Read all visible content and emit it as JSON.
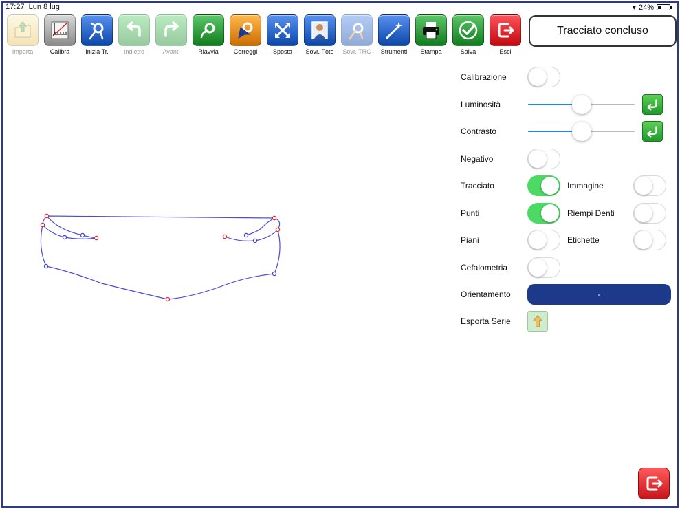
{
  "status_bar": {
    "time": "17:27",
    "date": "Lun 8 lug",
    "battery": "24%",
    "battery_level": 0.24
  },
  "toolbar": [
    {
      "id": "importa",
      "label": "Importa",
      "enabled": false,
      "icon": "folder-import-icon",
      "color": "#e8c25a"
    },
    {
      "id": "calibra",
      "label": "Calibra",
      "enabled": true,
      "icon": "ruler-calibrate-icon",
      "color": "#8a8a8a"
    },
    {
      "id": "inizia",
      "label": "Inizia Tr.",
      "enabled": true,
      "icon": "start-trace-icon",
      "color": "#2a64c4"
    },
    {
      "id": "indietro",
      "label": "Indietro",
      "enabled": false,
      "icon": "undo-arrow-icon",
      "color": "#3aa84a"
    },
    {
      "id": "avanti",
      "label": "Avanti",
      "enabled": false,
      "icon": "redo-arrow-icon",
      "color": "#3aa84a"
    },
    {
      "id": "riavvia",
      "label": "Riavvia",
      "enabled": true,
      "icon": "restart-trace-icon",
      "color": "#2f9a3c"
    },
    {
      "id": "correggi",
      "label": "Correggi",
      "enabled": true,
      "icon": "correct-cursor-icon",
      "color": "#ea8b1f"
    },
    {
      "id": "sposta",
      "label": "Sposta",
      "enabled": true,
      "icon": "move-arrows-icon",
      "color": "#2a64c4"
    },
    {
      "id": "sovr_foto",
      "label": "Sovr. Foto",
      "enabled": true,
      "icon": "overlay-photo-icon",
      "color": "#2a64c4"
    },
    {
      "id": "sovr_trc",
      "label": "Sovr. TRC",
      "enabled": false,
      "icon": "overlay-trace-icon",
      "color": "#2a64c4"
    },
    {
      "id": "strumenti",
      "label": "Strumenti",
      "enabled": true,
      "icon": "magic-wand-icon",
      "color": "#2a64c4"
    },
    {
      "id": "stampa",
      "label": "Stampa",
      "enabled": true,
      "icon": "printer-icon",
      "color": "#2f9a3c"
    },
    {
      "id": "salva",
      "label": "Salva",
      "enabled": true,
      "icon": "checkmark-save-icon",
      "color": "#2f9a3c"
    },
    {
      "id": "esci",
      "label": "Esci",
      "enabled": true,
      "icon": "exit-door-icon",
      "color": "#e0262d"
    }
  ],
  "status_button": "Tracciato concluso",
  "settings": {
    "calibrazione": {
      "label": "Calibrazione",
      "on": false
    },
    "luminosita": {
      "label": "Luminosità",
      "value": 0.5
    },
    "contrasto": {
      "label": "Contrasto",
      "value": 0.5
    },
    "negativo": {
      "label": "Negativo",
      "on": false
    },
    "tracciato": {
      "label": "Tracciato",
      "on": true
    },
    "immagine": {
      "label": "Immagine",
      "on": false
    },
    "punti": {
      "label": "Punti",
      "on": true
    },
    "riempi_denti": {
      "label": "Riempi Denti",
      "on": false
    },
    "piani": {
      "label": "Piani",
      "on": false
    },
    "etichette": {
      "label": "Etichette",
      "on": false
    },
    "cefalometria": {
      "label": "Cefalometria",
      "on": false
    },
    "orientamento": {
      "label": "Orientamento",
      "value": "-"
    },
    "esporta_serie": {
      "label": "Esporta Serie"
    }
  },
  "colors": {
    "accent_blue": "#1d3a8a",
    "toggle_on": "#4cd964",
    "trace_line": "#4b4bd6",
    "trace_point_red": "#e0262d",
    "trace_point_blue": "#3a3ad0"
  }
}
